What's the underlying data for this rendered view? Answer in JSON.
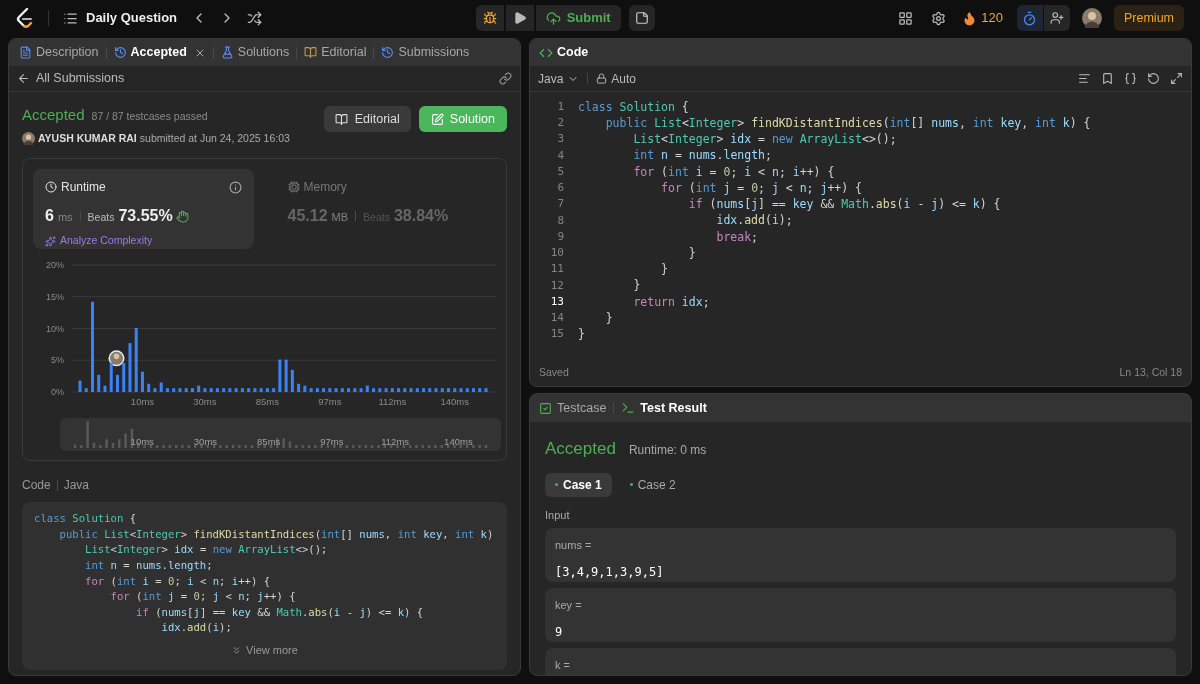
{
  "top_bar": {
    "problem_list": "Daily Question",
    "submit": "Submit",
    "streak": "120",
    "premium": "Premium"
  },
  "left_panel": {
    "tabs": [
      {
        "kind": "description",
        "label": "Description",
        "selected": false,
        "closable": false
      },
      {
        "kind": "result",
        "label": "Accepted",
        "selected": true,
        "closable": true
      },
      {
        "kind": "solutions",
        "label": "Solutions",
        "selected": false,
        "closable": false
      },
      {
        "kind": "editorial",
        "label": "Editorial",
        "selected": false,
        "closable": false
      },
      {
        "kind": "submissions",
        "label": "Submissions",
        "selected": false,
        "closable": false
      }
    ],
    "back_link": "All Submissions",
    "result": {
      "status": "Accepted",
      "testcases": "87 / 87 testcases passed",
      "author": "AYUSH KUMAR RAI",
      "submitted": "submitted at Jun 24, 2025 16:03"
    },
    "buttons": [
      {
        "kind": "editorial",
        "label": "Editorial"
      },
      {
        "kind": "solution",
        "label": "Solution"
      }
    ],
    "stats": [
      {
        "kind": "runtime",
        "title": "Runtime",
        "value": "6",
        "unit": "ms",
        "beats_label": "Beats",
        "beats": "73.55%",
        "selected": true,
        "action": "Analyze Complexity"
      },
      {
        "kind": "memory",
        "title": "Memory",
        "value": "45.12",
        "unit": "MB",
        "beats_label": "Beats",
        "beats": "38.84%",
        "selected": false
      }
    ],
    "chart_data": {
      "type": "bar",
      "grid": true,
      "ylim": [
        0,
        20
      ],
      "yticks": [
        {
          "value": 0,
          "label": "0%"
        },
        {
          "value": 5,
          "label": "5%"
        },
        {
          "value": 10,
          "label": "10%"
        },
        {
          "value": 15,
          "label": "15%"
        },
        {
          "value": 20,
          "label": "20%"
        }
      ],
      "categories": [
        null,
        null,
        null,
        null,
        null,
        null,
        null,
        null,
        null,
        null,
        "10ms",
        null,
        null,
        null,
        null,
        null,
        null,
        null,
        null,
        null,
        "30ms",
        null,
        null,
        null,
        null,
        null,
        null,
        null,
        null,
        null,
        "85ms",
        null,
        null,
        null,
        null,
        null,
        null,
        null,
        null,
        null,
        "97ms",
        null,
        null,
        null,
        null,
        null,
        null,
        null,
        null,
        null,
        "112ms",
        null,
        null,
        null,
        null,
        null,
        null,
        null,
        null,
        null,
        "140ms",
        null,
        null,
        null,
        null,
        null
      ],
      "values": [
        1.8,
        0.6,
        14.2,
        2.7,
        1.0,
        4.6,
        2.7,
        4.6,
        7.7,
        10.1,
        3.2,
        1.3,
        0.6,
        1.5,
        0.6,
        0.6,
        0.6,
        0.6,
        0.6,
        1.0,
        0.6,
        0.6,
        0.6,
        0.6,
        0.6,
        0.6,
        0.6,
        0.6,
        0.6,
        0.6,
        0.6,
        0.6,
        5.1,
        5.1,
        3.5,
        1.3,
        1.0,
        0.6,
        0.6,
        0.6,
        0.6,
        0.6,
        0.6,
        0.6,
        0.6,
        0.6,
        1.0,
        0.6,
        0.6,
        0.6,
        0.6,
        0.6,
        0.6,
        0.6,
        0.6,
        0.6,
        0.6,
        0.6,
        0.6,
        0.6,
        0.6,
        0.6,
        0.6,
        0.6,
        0.6,
        0.6
      ]
    },
    "overview_labels": [
      "10ms",
      "30ms",
      "85ms",
      "97ms",
      "112ms",
      "140ms"
    ],
    "code_header": {
      "title": "Code",
      "language": "Java"
    },
    "code_lines": [
      [
        {
          "kind": "kw",
          "text": "class"
        },
        {
          "kind": "ty",
          "text": " Solution"
        },
        {
          "kind": "p",
          "text": " {"
        }
      ],
      [
        {
          "kind": "kw",
          "text": "    public"
        },
        {
          "kind": "ty",
          "text": " List"
        },
        {
          "kind": "p",
          "text": "<"
        },
        {
          "kind": "ty",
          "text": "Integer"
        },
        {
          "kind": "p",
          "text": "> "
        },
        {
          "kind": "fn",
          "text": "findKDistantIndices"
        },
        {
          "kind": "p",
          "text": "("
        },
        {
          "kind": "kw",
          "text": "int"
        },
        {
          "kind": "p",
          "text": "[] "
        },
        {
          "kind": "v",
          "text": "nums"
        },
        {
          "kind": "p",
          "text": ", "
        },
        {
          "kind": "kw",
          "text": "int"
        },
        {
          "kind": "v",
          "text": " key"
        },
        {
          "kind": "p",
          "text": ", "
        },
        {
          "kind": "kw",
          "text": "int"
        },
        {
          "kind": "v",
          "text": " k"
        },
        {
          "kind": "p",
          "text": ")"
        }
      ],
      [
        {
          "kind": "ty",
          "text": "        List"
        },
        {
          "kind": "p",
          "text": "<"
        },
        {
          "kind": "ty",
          "text": "Integer"
        },
        {
          "kind": "p",
          "text": "> "
        },
        {
          "kind": "v",
          "text": "idx"
        },
        {
          "kind": "p",
          "text": " = "
        },
        {
          "kind": "kw",
          "text": "new"
        },
        {
          "kind": "ty",
          "text": " ArrayList"
        },
        {
          "kind": "p",
          "text": "<>();"
        }
      ],
      [
        {
          "kind": "kw",
          "text": "        int"
        },
        {
          "kind": "v",
          "text": " n"
        },
        {
          "kind": "p",
          "text": " = "
        },
        {
          "kind": "v",
          "text": "nums"
        },
        {
          "kind": "p",
          "text": "."
        },
        {
          "kind": "v",
          "text": "length"
        },
        {
          "kind": "p",
          "text": ";"
        }
      ],
      [
        {
          "kind": "ctl",
          "text": "        for"
        },
        {
          "kind": "p",
          "text": " ("
        },
        {
          "kind": "kw",
          "text": "int"
        },
        {
          "kind": "v",
          "text": " i"
        },
        {
          "kind": "p",
          "text": " = "
        },
        {
          "kind": "num",
          "text": "0"
        },
        {
          "kind": "p",
          "text": "; "
        },
        {
          "kind": "v",
          "text": "i"
        },
        {
          "kind": "p",
          "text": " < "
        },
        {
          "kind": "v",
          "text": "n"
        },
        {
          "kind": "p",
          "text": "; "
        },
        {
          "kind": "v",
          "text": "i"
        },
        {
          "kind": "p",
          "text": "++) {"
        }
      ],
      [
        {
          "kind": "ctl",
          "text": "            for"
        },
        {
          "kind": "p",
          "text": " ("
        },
        {
          "kind": "kw",
          "text": "int"
        },
        {
          "kind": "v",
          "text": " j"
        },
        {
          "kind": "p",
          "text": " = "
        },
        {
          "kind": "num",
          "text": "0"
        },
        {
          "kind": "p",
          "text": "; "
        },
        {
          "kind": "v",
          "text": "j"
        },
        {
          "kind": "p",
          "text": " < "
        },
        {
          "kind": "v",
          "text": "n"
        },
        {
          "kind": "p",
          "text": "; "
        },
        {
          "kind": "v",
          "text": "j"
        },
        {
          "kind": "p",
          "text": "++) {"
        }
      ],
      [
        {
          "kind": "ctl",
          "text": "                if"
        },
        {
          "kind": "p",
          "text": " ("
        },
        {
          "kind": "v",
          "text": "nums"
        },
        {
          "kind": "p",
          "text": "["
        },
        {
          "kind": "v",
          "text": "j"
        },
        {
          "kind": "p",
          "text": "] == "
        },
        {
          "kind": "v",
          "text": "key"
        },
        {
          "kind": "p",
          "text": " && "
        },
        {
          "kind": "ty",
          "text": "Math"
        },
        {
          "kind": "p",
          "text": "."
        },
        {
          "kind": "fn",
          "text": "abs"
        },
        {
          "kind": "p",
          "text": "("
        },
        {
          "kind": "v",
          "text": "i"
        },
        {
          "kind": "p",
          "text": " - "
        },
        {
          "kind": "v",
          "text": "j"
        },
        {
          "kind": "p",
          "text": ") <= "
        },
        {
          "kind": "v",
          "text": "k"
        },
        {
          "kind": "p",
          "text": ") {"
        }
      ],
      [
        {
          "kind": "v",
          "text": "                    idx"
        },
        {
          "kind": "p",
          "text": "."
        },
        {
          "kind": "fn",
          "text": "add"
        },
        {
          "kind": "p",
          "text": "("
        },
        {
          "kind": "v",
          "text": "i"
        },
        {
          "kind": "p",
          "text": ");"
        }
      ]
    ],
    "view_more": "View more"
  },
  "editor": {
    "title": "Code",
    "language": "Java",
    "mode": "Auto",
    "lines": [
      {
        "number": "1",
        "current": false,
        "tokens": [
          {
            "kind": "kw",
            "text": "class"
          },
          {
            "kind": "ty",
            "text": " Solution"
          },
          {
            "kind": "p",
            "text": " {"
          }
        ]
      },
      {
        "number": "2",
        "current": false,
        "tokens": [
          {
            "kind": "kw",
            "text": "    public"
          },
          {
            "kind": "ty",
            "text": " List"
          },
          {
            "kind": "p",
            "text": "<"
          },
          {
            "kind": "ty",
            "text": "Integer"
          },
          {
            "kind": "p",
            "text": "> "
          },
          {
            "kind": "fn",
            "text": "findKDistantIndices"
          },
          {
            "kind": "p",
            "text": "("
          },
          {
            "kind": "kw",
            "text": "int"
          },
          {
            "kind": "p",
            "text": "[] "
          },
          {
            "kind": "v",
            "text": "nums"
          },
          {
            "kind": "p",
            "text": ", "
          },
          {
            "kind": "kw",
            "text": "int"
          },
          {
            "kind": "v",
            "text": " key"
          },
          {
            "kind": "p",
            "text": ", "
          },
          {
            "kind": "kw",
            "text": "int"
          },
          {
            "kind": "v",
            "text": " k"
          },
          {
            "kind": "p",
            "text": ") {"
          }
        ]
      },
      {
        "number": "3",
        "current": false,
        "tokens": [
          {
            "kind": "ty",
            "text": "        List"
          },
          {
            "kind": "p",
            "text": "<"
          },
          {
            "kind": "ty",
            "text": "Integer"
          },
          {
            "kind": "p",
            "text": "> "
          },
          {
            "kind": "v",
            "text": "idx"
          },
          {
            "kind": "p",
            "text": " = "
          },
          {
            "kind": "kw",
            "text": "new"
          },
          {
            "kind": "ty",
            "text": " ArrayList"
          },
          {
            "kind": "p",
            "text": "<>();"
          }
        ]
      },
      {
        "number": "4",
        "current": false,
        "tokens": [
          {
            "kind": "kw",
            "text": "        int"
          },
          {
            "kind": "v",
            "text": " n"
          },
          {
            "kind": "p",
            "text": " = "
          },
          {
            "kind": "v",
            "text": "nums"
          },
          {
            "kind": "p",
            "text": "."
          },
          {
            "kind": "v",
            "text": "length"
          },
          {
            "kind": "p",
            "text": ";"
          }
        ]
      },
      {
        "number": "5",
        "current": false,
        "tokens": [
          {
            "kind": "ctl",
            "text": "        for"
          },
          {
            "kind": "p",
            "text": " ("
          },
          {
            "kind": "kw",
            "text": "int"
          },
          {
            "kind": "v",
            "text": " i"
          },
          {
            "kind": "p",
            "text": " = "
          },
          {
            "kind": "num",
            "text": "0"
          },
          {
            "kind": "p",
            "text": "; "
          },
          {
            "kind": "v",
            "text": "i"
          },
          {
            "kind": "p",
            "text": " < "
          },
          {
            "kind": "v",
            "text": "n"
          },
          {
            "kind": "p",
            "text": "; "
          },
          {
            "kind": "v",
            "text": "i"
          },
          {
            "kind": "p",
            "text": "++) {"
          }
        ]
      },
      {
        "number": "6",
        "current": false,
        "tokens": [
          {
            "kind": "ctl",
            "text": "            for"
          },
          {
            "kind": "p",
            "text": " ("
          },
          {
            "kind": "kw",
            "text": "int"
          },
          {
            "kind": "v",
            "text": " j"
          },
          {
            "kind": "p",
            "text": " = "
          },
          {
            "kind": "num",
            "text": "0"
          },
          {
            "kind": "p",
            "text": "; "
          },
          {
            "kind": "v",
            "text": "j"
          },
          {
            "kind": "p",
            "text": " < "
          },
          {
            "kind": "v",
            "text": "n"
          },
          {
            "kind": "p",
            "text": "; "
          },
          {
            "kind": "v",
            "text": "j"
          },
          {
            "kind": "p",
            "text": "++) {"
          }
        ]
      },
      {
        "number": "7",
        "current": false,
        "tokens": [
          {
            "kind": "ctl",
            "text": "                if"
          },
          {
            "kind": "p",
            "text": " ("
          },
          {
            "kind": "v",
            "text": "nums"
          },
          {
            "kind": "p",
            "text": "["
          },
          {
            "kind": "v",
            "text": "j"
          },
          {
            "kind": "p",
            "text": "] == "
          },
          {
            "kind": "v",
            "text": "key"
          },
          {
            "kind": "p",
            "text": " && "
          },
          {
            "kind": "ty",
            "text": "Math"
          },
          {
            "kind": "p",
            "text": "."
          },
          {
            "kind": "fn",
            "text": "abs"
          },
          {
            "kind": "p",
            "text": "("
          },
          {
            "kind": "v",
            "text": "i"
          },
          {
            "kind": "p",
            "text": " - "
          },
          {
            "kind": "v",
            "text": "j"
          },
          {
            "kind": "p",
            "text": ") <= "
          },
          {
            "kind": "v",
            "text": "k"
          },
          {
            "kind": "p",
            "text": ") {"
          }
        ]
      },
      {
        "number": "8",
        "current": false,
        "tokens": [
          {
            "kind": "v",
            "text": "                    idx"
          },
          {
            "kind": "p",
            "text": "."
          },
          {
            "kind": "fn",
            "text": "add"
          },
          {
            "kind": "p",
            "text": "("
          },
          {
            "kind": "v",
            "text": "i"
          },
          {
            "kind": "p",
            "text": ");"
          }
        ]
      },
      {
        "number": "9",
        "current": false,
        "tokens": [
          {
            "kind": "ctl",
            "text": "                    break"
          },
          {
            "kind": "p",
            "text": ";"
          }
        ]
      },
      {
        "number": "10",
        "current": false,
        "tokens": [
          {
            "kind": "p",
            "text": "                }"
          }
        ]
      },
      {
        "number": "11",
        "current": false,
        "tokens": [
          {
            "kind": "p",
            "text": "            }"
          }
        ]
      },
      {
        "number": "12",
        "current": false,
        "tokens": [
          {
            "kind": "p",
            "text": "        }"
          }
        ]
      },
      {
        "number": "13",
        "current": true,
        "tokens": [
          {
            "kind": "ctl",
            "text": "        return"
          },
          {
            "kind": "v",
            "text": " idx"
          },
          {
            "kind": "p",
            "text": ";"
          }
        ]
      },
      {
        "number": "14",
        "current": false,
        "tokens": [
          {
            "kind": "p",
            "text": "    }"
          }
        ]
      },
      {
        "number": "15",
        "current": false,
        "tokens": [
          {
            "kind": "p",
            "text": "}"
          }
        ]
      }
    ],
    "status": "Saved",
    "cursor": "Ln 13, Col 18"
  },
  "test_panel": {
    "tabs": [
      {
        "kind": "testcase",
        "label": "Testcase",
        "selected": false
      },
      {
        "kind": "result",
        "label": "Test Result",
        "selected": true
      }
    ],
    "status": "Accepted",
    "runtime": "Runtime: 0 ms",
    "cases": [
      {
        "label": "Case 1",
        "selected": true
      },
      {
        "label": "Case 2",
        "selected": false
      }
    ],
    "input_label": "Input",
    "inputs": [
      {
        "name": "nums =",
        "value": "[3,4,9,1,3,9,5]"
      },
      {
        "name": "key =",
        "value": "9"
      },
      {
        "name": "k ="
      }
    ]
  }
}
